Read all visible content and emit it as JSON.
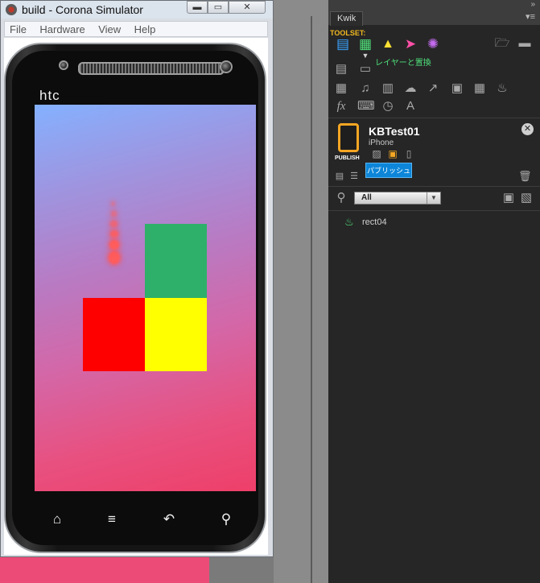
{
  "simulator": {
    "title": "build - Corona Simulator",
    "controls": {
      "min": "▬",
      "max": "▭",
      "close": "✕"
    },
    "menu": [
      "File",
      "Hardware",
      "View",
      "Help"
    ],
    "device_brand": "htc",
    "nav_keys": [
      "⌂",
      "≡",
      "↶",
      "⚲"
    ],
    "scene_colors": {
      "green": "#2eb06a",
      "red": "#ff0000",
      "yellow": "#ffff00"
    }
  },
  "kwik": {
    "tab_label": "Kwik",
    "toolset_label": "TOOLSET:",
    "toolset_tooltip": "レイヤーと置換",
    "project": {
      "name": "KBTest01",
      "device": "iPhone",
      "publish_label": "PUBLISH",
      "publish_tooltip": "パブリッシュ"
    },
    "layer_filter": {
      "selected": "All"
    },
    "layers": [
      {
        "name": "rect04",
        "icon": "fire-icon"
      }
    ]
  }
}
